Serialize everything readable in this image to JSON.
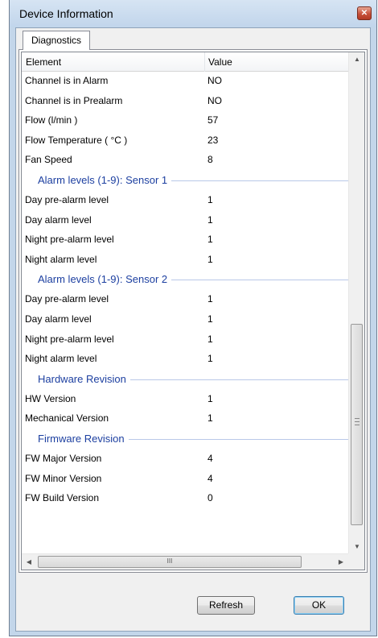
{
  "window": {
    "title": "Device Information"
  },
  "tabs": [
    {
      "label": "Diagnostics"
    }
  ],
  "table": {
    "columns": [
      "Element",
      "Value"
    ],
    "rows": [
      {
        "element": "Channel is in Alarm",
        "value": "NO"
      },
      {
        "element": "Channel is in Prealarm",
        "value": "NO"
      },
      {
        "element": "Flow (l/min )",
        "value": "57"
      },
      {
        "element": "Flow Temperature ( °C )",
        "value": "23"
      },
      {
        "element": "Fan Speed",
        "value": "8"
      }
    ],
    "groups": [
      {
        "title": "Alarm levels (1-9): Sensor 1",
        "rows": [
          {
            "element": "Day pre-alarm level",
            "value": "1"
          },
          {
            "element": "Day alarm level",
            "value": "1"
          },
          {
            "element": "Night pre-alarm level",
            "value": "1"
          },
          {
            "element": "Night alarm level",
            "value": "1"
          }
        ]
      },
      {
        "title": "Alarm levels (1-9): Sensor 2",
        "rows": [
          {
            "element": "Day pre-alarm level",
            "value": "1"
          },
          {
            "element": "Day alarm level",
            "value": "1"
          },
          {
            "element": "Night pre-alarm level",
            "value": "1"
          },
          {
            "element": "Night alarm level",
            "value": "1"
          }
        ]
      },
      {
        "title": "Hardware Revision",
        "rows": [
          {
            "element": "HW Version",
            "value": "1"
          },
          {
            "element": "Mechanical Version",
            "value": "1"
          }
        ]
      },
      {
        "title": "Firmware Revision",
        "rows": [
          {
            "element": "FW Major Version",
            "value": "4"
          },
          {
            "element": "FW Minor Version",
            "value": "4"
          },
          {
            "element": "FW Build Version",
            "value": "0"
          }
        ]
      }
    ]
  },
  "buttons": {
    "refresh": "Refresh",
    "ok": "OK"
  }
}
